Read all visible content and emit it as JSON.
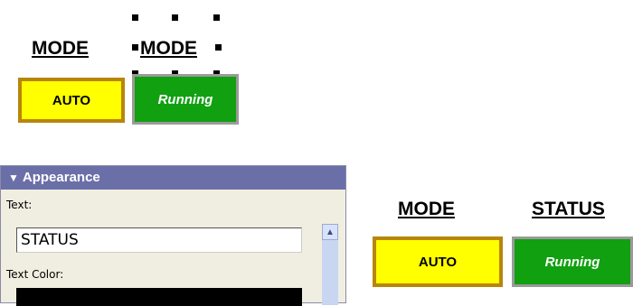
{
  "top_widgets": {
    "mode_label_1": "MODE",
    "mode_label_2": "MODE",
    "auto_button": "AUTO",
    "running_indicator": "Running"
  },
  "appearance_panel": {
    "header": "Appearance",
    "text_label": "Text:",
    "text_value": "STATUS",
    "text_color_label": "Text Color:",
    "text_color_value": "#000000"
  },
  "bottom_widgets": {
    "mode_label": "MODE",
    "status_label": "STATUS",
    "auto_button": "AUTO",
    "running_indicator": "Running"
  },
  "colors": {
    "auto_fill": "#ffff00",
    "auto_border": "#b8860b",
    "running_fill": "#10a010",
    "panel_header": "#6b6fa8",
    "panel_background": "#f0eee0"
  },
  "icons": {
    "collapse": "triangle-down-icon",
    "scroll_up": "chevron-up-icon"
  }
}
